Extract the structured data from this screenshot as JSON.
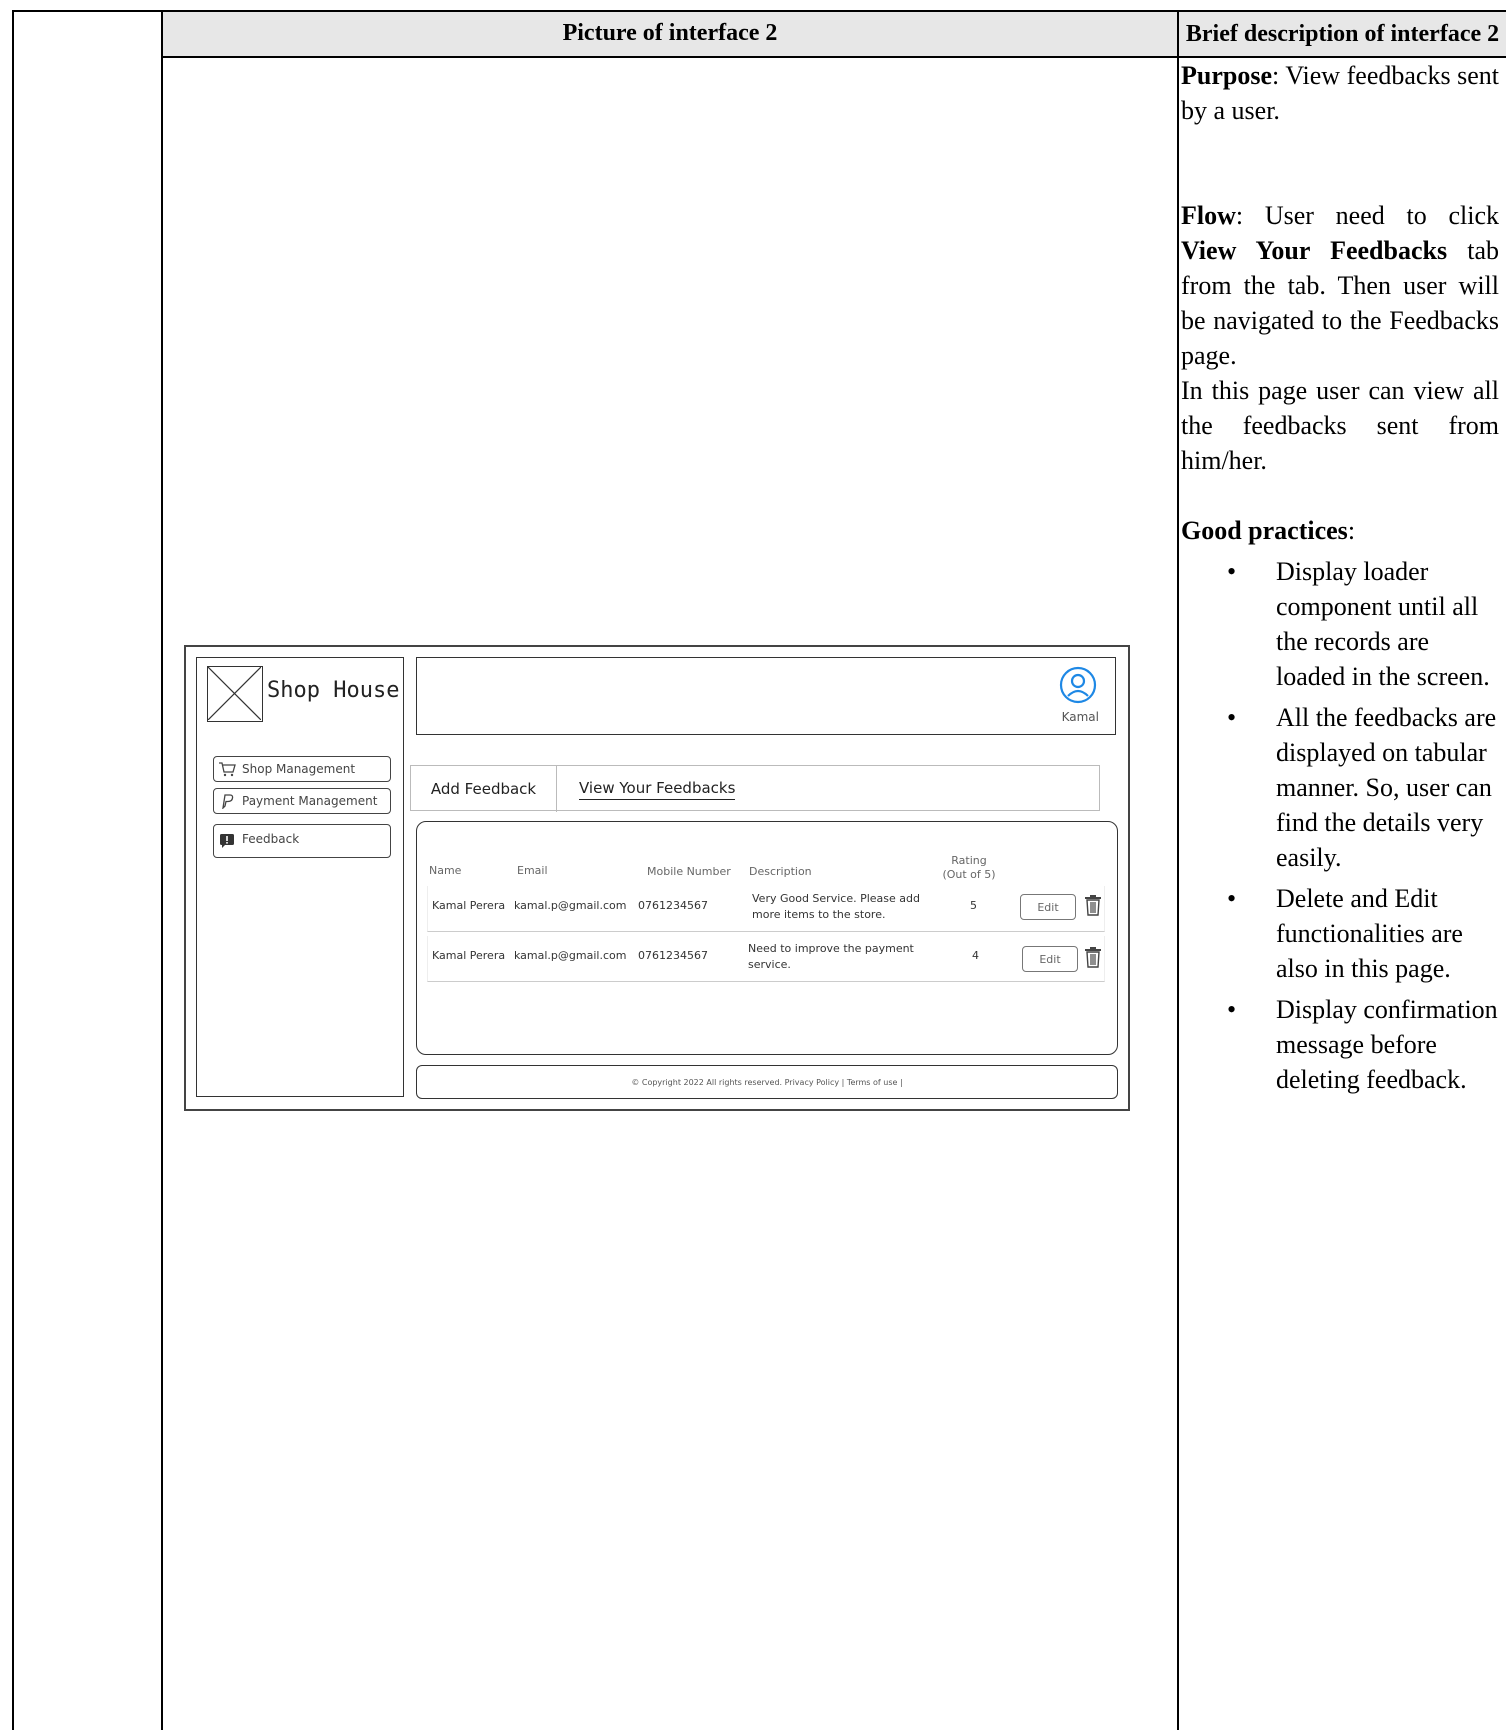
{
  "header": {
    "picture_col": "Picture of interface 2",
    "desc_col": "Brief description of interface 2"
  },
  "description": {
    "purpose_label": "Purpose",
    "purpose_text": "View feedbacks sent by a user.",
    "flow_label": "Flow",
    "flow_text_1": "User need to click",
    "flow_bold": "View Your Feedbacks",
    "flow_text_2": "tab from the tab. Then user will be navigated to the Feedbacks page.",
    "flow_text_3": "In this page user can view all the feedbacks sent from him/her.",
    "good_label": "Good practices",
    "practices": [
      "Display loader component until all the records are loaded in the screen.",
      "All the feedbacks are displayed on tabular manner. So, user can find the details very easily.",
      "Delete and Edit functionalities are also in this page.",
      "Display confirmation message before deleting feedback."
    ]
  },
  "wireframe": {
    "brand": "Shop House",
    "nav": [
      "Shop Management",
      "Payment Management",
      "Feedback"
    ],
    "user_name": "Kamal",
    "tabs": [
      "Add Feedback",
      "View Your Feedbacks"
    ],
    "columns": [
      "Name",
      "Email",
      "Mobile Number",
      "Description",
      "Rating",
      "(Out of 5)"
    ],
    "rows": [
      {
        "name": "Kamal Perera",
        "email": "kamal.p@gmail.com",
        "mobile": "0761234567",
        "desc_1": "Very Good Service. Please add",
        "desc_2": "more items to the store.",
        "rating": "5",
        "edit": "Edit"
      },
      {
        "name": "Kamal Perera",
        "email": "kamal.p@gmail.com",
        "mobile": "0761234567",
        "desc_1": "Need to improve the payment",
        "desc_2": "service.",
        "rating": "4",
        "edit": "Edit"
      }
    ],
    "footer": "© Copyright 2022 All rights reserved. Privacy Policy | Terms of use |"
  }
}
